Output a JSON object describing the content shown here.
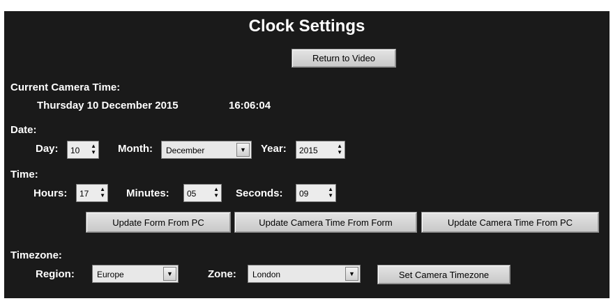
{
  "title": "Clock Settings",
  "return_button": "Return to Video",
  "current": {
    "label": "Current Camera Time:",
    "date": "Thursday 10 December 2015",
    "time": "16:06:04"
  },
  "date_section": {
    "label": "Date:",
    "day_label": "Day:",
    "day_value": "10",
    "month_label": "Month:",
    "month_value": "December",
    "year_label": "Year:",
    "year_value": "2015"
  },
  "time_section": {
    "label": "Time:",
    "hours_label": "Hours:",
    "hours_value": "17",
    "minutes_label": "Minutes:",
    "minutes_value": "05",
    "seconds_label": "Seconds:",
    "seconds_value": "09"
  },
  "actions": {
    "update_form": "Update Form From PC",
    "update_camera_form": "Update Camera Time From Form",
    "update_camera_pc": "Update Camera Time From PC"
  },
  "timezone": {
    "label": "Timezone:",
    "region_label": "Region:",
    "region_value": "Europe",
    "zone_label": "Zone:",
    "zone_value": "London",
    "set_button": "Set Camera Timezone"
  }
}
